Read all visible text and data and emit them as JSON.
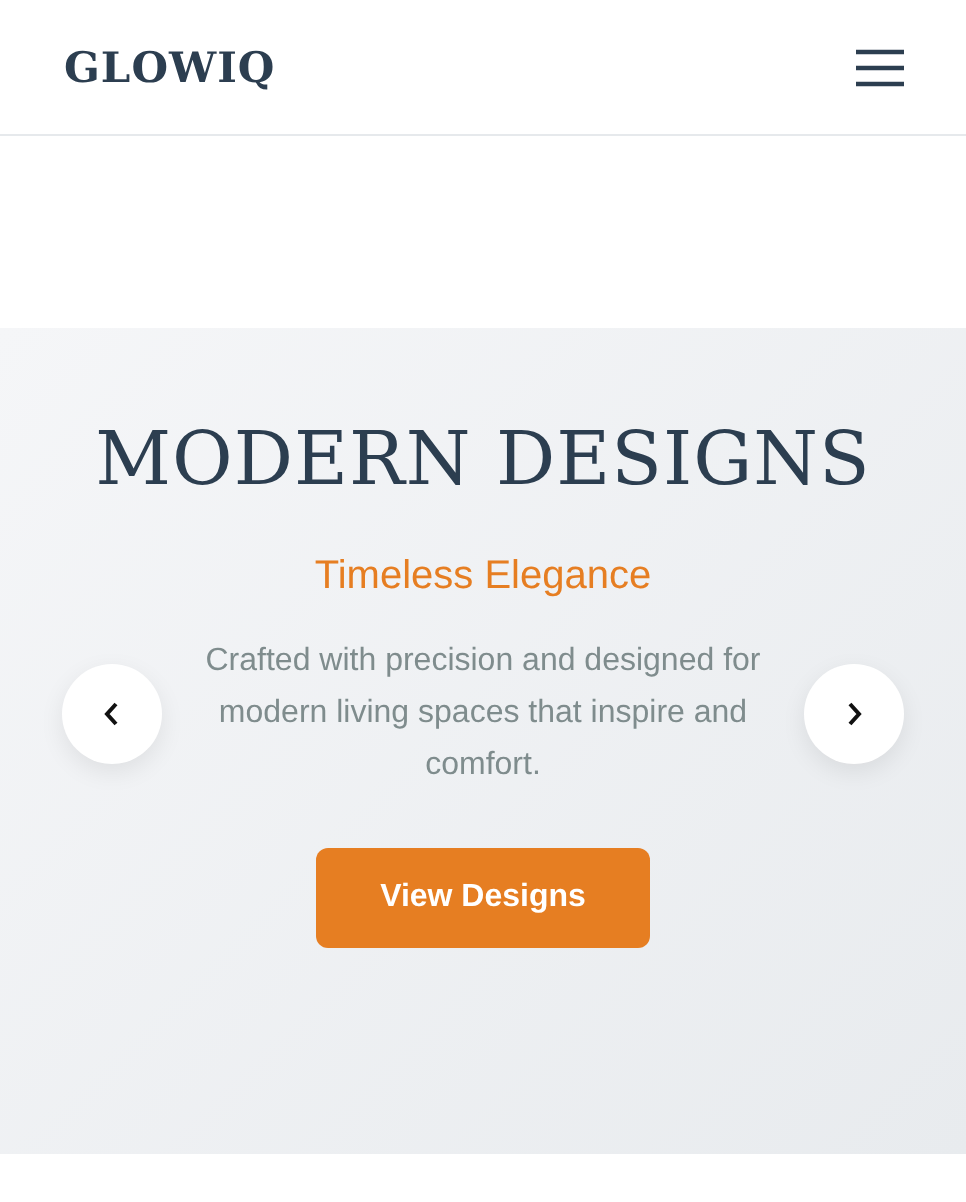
{
  "header": {
    "logo": "GLOWIQ"
  },
  "hero": {
    "title": "MODERN DESIGNS",
    "subtitle": "Timeless Elegance",
    "description": "Crafted with precision and designed for modern living spaces that inspire and comfort.",
    "button": "View Designs"
  }
}
